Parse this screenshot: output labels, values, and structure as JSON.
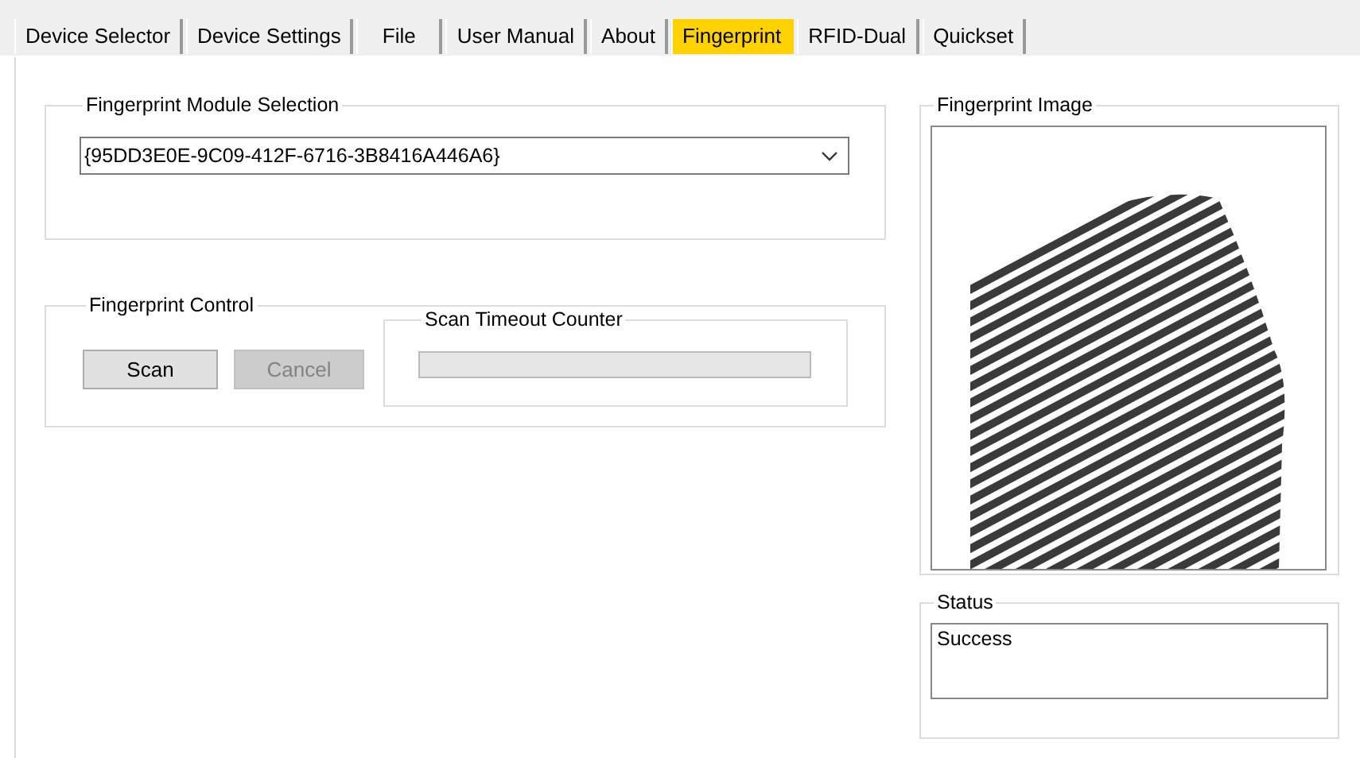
{
  "tabs": [
    {
      "label": "Device Selector",
      "selected": false
    },
    {
      "label": "Device Settings",
      "selected": false
    },
    {
      "label": "File",
      "selected": false
    },
    {
      "label": "User Manual",
      "selected": false
    },
    {
      "label": "About",
      "selected": false
    },
    {
      "label": "Fingerprint",
      "selected": true
    },
    {
      "label": "RFID-Dual",
      "selected": false
    },
    {
      "label": "Quickset",
      "selected": false
    }
  ],
  "module_selection": {
    "title": "Fingerprint Module Selection",
    "value": "{95DD3E0E-9C09-412F-6716-3B8416A446A6}"
  },
  "control": {
    "title": "Fingerprint Control",
    "buttons": [
      {
        "label": "Scan",
        "disabled": false
      },
      {
        "label": "Cancel",
        "disabled": true
      }
    ],
    "timeout": {
      "title": "Scan Timeout Counter",
      "level": 0
    }
  },
  "image": {
    "title": "Fingerprint Image"
  },
  "status": {
    "title": "Status",
    "value": "Success"
  }
}
